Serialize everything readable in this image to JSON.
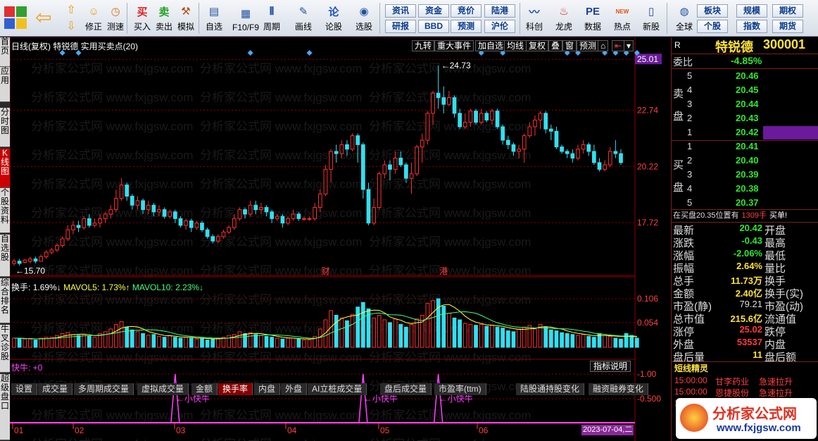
{
  "toolbar": {
    "buttons": [
      {
        "label": "修正",
        "icon": "arrow-up-icon"
      },
      {
        "label": "测速",
        "icon": "clock-icon"
      },
      {
        "label": "买入",
        "icon": "buy-icon"
      },
      {
        "label": "卖出",
        "icon": "sell-icon"
      },
      {
        "label": "模拟",
        "icon": "hammer-icon"
      },
      {
        "label": "自选",
        "icon": "folder-icon"
      },
      {
        "label": "F10/F9",
        "icon": "f10-icon"
      },
      {
        "label": "周期",
        "icon": "period-icon"
      },
      {
        "label": "画线",
        "icon": "pencil-icon"
      },
      {
        "label": "论股",
        "icon": "forum-icon"
      },
      {
        "label": "选股",
        "icon": "select-stock-icon"
      },
      {
        "label": "科创",
        "icon": "kechuang-icon"
      },
      {
        "label": "龙虎",
        "icon": "dragon-tiger-icon"
      },
      {
        "label": "数据",
        "icon": "pe-icon"
      },
      {
        "label": "热点",
        "icon": "hot-icon"
      },
      {
        "label": "新股",
        "icon": "new-stock-icon"
      },
      {
        "label": "全球",
        "icon": "globe-icon"
      }
    ],
    "glyphs": {
      "buy": "买",
      "sell": "卖",
      "forum": "论",
      "pe": "PE",
      "hot": "NEW"
    },
    "menu": [
      [
        "资讯",
        "资金",
        "竞价",
        "陆港"
      ],
      [
        "研报",
        "BBD",
        "预测",
        "沪伦"
      ],
      [
        "板块",
        "规模",
        "期权"
      ],
      [
        "个股",
        "指数",
        "期货"
      ]
    ]
  },
  "leftnav": [
    "首页",
    "应用",
    "分时图",
    "K线图",
    "个股资料",
    "自选股",
    "综合排名",
    "牛叉诊股",
    "超级盘口"
  ],
  "chart": {
    "title": "日线(复权)  特锐德  实用买卖点(20)",
    "tabs": [
      "九转",
      "重大事件",
      "加自选",
      "均线",
      "复权",
      "叠",
      "窗",
      "预测"
    ],
    "price_labels": [
      "25.01",
      "22.74",
      "20.22",
      "17.72"
    ],
    "high_label": "24.73",
    "low_label": "15.70",
    "event_labels": [
      "财",
      "港"
    ],
    "volume_indicator": {
      "name": "换手:",
      "value": "1.69%",
      "arrow1": "↓",
      "ma5_label": "MAVOL5:",
      "ma5": "1.73%",
      "arrow2": "↑",
      "ma10_label": "MAVOL10:",
      "ma10": "2.23%",
      "arrow3": "↓"
    },
    "volume_ticks": [
      "0.106",
      "0.054"
    ],
    "bottom_tabs": [
      "设置",
      "成交量",
      "多周期成交量",
      "虚拟成交量",
      "金额",
      "换手率",
      "内盘",
      "外盘",
      "AI立桩成交量",
      "盘后成交量",
      "市盈率(ttm)",
      "陆股通持股变化",
      "融资融券变化"
    ],
    "active_bottom_tab": "换手率",
    "fast_title": "快牛: +0",
    "indicator_button": "指标说明",
    "fast_ticks": [
      "1.00",
      "0.500"
    ],
    "signal_label": "小快牛",
    "date_labels": [
      "01",
      "02",
      "03",
      "04",
      "05",
      "06"
    ],
    "date_current": "2023-07-04,二",
    "watermark": "分析家公式网 www.fxjgsw.com",
    "colors": {
      "up": "#ff3030",
      "down": "#30e0f0",
      "grid": "#8a0000",
      "magenta": "#ff40ff"
    }
  },
  "chart_data": {
    "type": "candlestick",
    "high": 24.73,
    "low": 15.7,
    "price_axis": [
      17.72,
      20.22,
      22.74,
      25.01
    ],
    "candles": [
      [
        15.9,
        16.0,
        15.8,
        16.1
      ],
      [
        16.0,
        15.9,
        15.8,
        16.1
      ],
      [
        15.95,
        16.05,
        15.9,
        16.1
      ],
      [
        16.0,
        16.1,
        15.9,
        16.2
      ],
      [
        16.1,
        16.0,
        15.9,
        16.2
      ],
      [
        16.0,
        16.2,
        16.0,
        16.3
      ],
      [
        16.2,
        16.4,
        16.1,
        16.5
      ],
      [
        16.4,
        16.5,
        16.3,
        16.6
      ],
      [
        16.5,
        16.7,
        16.4,
        16.8
      ],
      [
        16.7,
        17.0,
        16.6,
        17.1
      ],
      [
        17.0,
        17.4,
        16.9,
        17.6
      ],
      [
        17.4,
        17.6,
        17.2,
        17.8
      ],
      [
        17.6,
        17.5,
        17.3,
        17.8
      ],
      [
        17.5,
        17.9,
        17.4,
        18.0
      ],
      [
        17.9,
        17.6,
        17.5,
        18.1
      ],
      [
        17.6,
        17.7,
        17.5,
        17.9
      ],
      [
        17.7,
        17.9,
        17.5,
        18.1
      ],
      [
        17.9,
        18.1,
        17.7,
        18.2
      ],
      [
        18.1,
        18.3,
        17.9,
        18.5
      ],
      [
        18.3,
        18.8,
        18.2,
        19.2
      ],
      [
        18.8,
        19.4,
        18.7,
        19.7
      ],
      [
        19.4,
        18.9,
        18.7,
        19.5
      ],
      [
        18.9,
        18.5,
        18.3,
        19.0
      ],
      [
        18.5,
        18.7,
        18.3,
        18.9
      ],
      [
        18.7,
        18.3,
        18.1,
        18.8
      ],
      [
        18.3,
        18.5,
        18.1,
        18.7
      ],
      [
        18.5,
        18.2,
        18.0,
        18.6
      ],
      [
        18.2,
        18.3,
        18.0,
        18.5
      ],
      [
        18.3,
        18.0,
        17.9,
        18.4
      ],
      [
        18.0,
        18.2,
        17.9,
        18.3
      ],
      [
        18.2,
        17.9,
        17.7,
        18.3
      ],
      [
        17.9,
        17.6,
        17.5,
        18.0
      ],
      [
        17.6,
        17.8,
        17.4,
        17.9
      ],
      [
        17.8,
        17.5,
        17.3,
        17.9
      ],
      [
        17.5,
        17.7,
        17.4,
        17.8
      ],
      [
        17.7,
        17.4,
        17.3,
        17.8
      ],
      [
        17.4,
        17.1,
        17.0,
        17.5
      ],
      [
        17.1,
        16.9,
        16.8,
        17.2
      ],
      [
        16.9,
        17.1,
        16.8,
        17.2
      ],
      [
        17.1,
        17.3,
        17.0,
        17.4
      ],
      [
        17.3,
        17.5,
        17.2,
        17.6
      ],
      [
        17.5,
        17.9,
        17.4,
        18.1
      ],
      [
        17.9,
        18.3,
        17.8,
        18.4
      ],
      [
        18.3,
        18.1,
        17.9,
        18.4
      ],
      [
        18.1,
        18.5,
        18.0,
        18.7
      ],
      [
        18.5,
        18.3,
        18.1,
        18.7
      ],
      [
        18.3,
        18.4,
        18.1,
        18.6
      ],
      [
        18.4,
        18.2,
        18.0,
        18.5
      ],
      [
        18.2,
        17.9,
        17.7,
        18.3
      ],
      [
        17.9,
        18.0,
        17.8,
        18.1
      ],
      [
        18.0,
        17.7,
        17.5,
        18.1
      ],
      [
        17.7,
        17.9,
        17.6,
        18.0
      ],
      [
        17.9,
        18.1,
        17.8,
        18.3
      ],
      [
        18.1,
        17.9,
        17.8,
        18.2
      ],
      [
        17.9,
        17.9,
        17.8,
        18.0
      ],
      [
        17.9,
        17.9,
        17.8,
        18.0
      ],
      [
        17.9,
        18.4,
        17.8,
        18.6
      ],
      [
        18.4,
        19.0,
        18.2,
        19.2
      ],
      [
        19.0,
        20.1,
        18.9,
        20.3
      ],
      [
        20.1,
        20.9,
        19.5,
        21.0
      ],
      [
        20.9,
        20.8,
        20.4,
        21.2
      ],
      [
        20.8,
        21.2,
        20.6,
        21.4
      ],
      [
        21.2,
        21.0,
        20.7,
        21.4
      ],
      [
        21.0,
        21.6,
        20.9,
        21.7
      ],
      [
        21.6,
        21.2,
        20.4,
        21.7
      ],
      [
        21.2,
        19.2,
        18.8,
        21.3
      ],
      [
        19.2,
        17.7,
        17.6,
        19.5
      ],
      [
        17.7,
        18.4,
        17.6,
        18.8
      ],
      [
        18.4,
        19.9,
        18.3,
        20.0
      ],
      [
        19.9,
        20.3,
        19.7,
        20.5
      ],
      [
        20.3,
        20.1,
        19.6,
        20.5
      ],
      [
        20.1,
        20.6,
        19.9,
        20.9
      ],
      [
        20.6,
        20.3,
        20.2,
        20.9
      ],
      [
        20.3,
        19.7,
        19.5,
        20.4
      ],
      [
        19.7,
        19.9,
        19.0,
        20.4
      ],
      [
        19.9,
        21.1,
        19.8,
        21.2
      ],
      [
        21.1,
        21.4,
        20.4,
        21.7
      ],
      [
        21.4,
        22.6,
        21.2,
        22.7
      ],
      [
        22.6,
        23.5,
        22.1,
        23.6
      ],
      [
        23.5,
        23.3,
        22.8,
        24.73
      ],
      [
        23.3,
        23.0,
        22.6,
        23.8
      ],
      [
        23.0,
        23.3,
        22.9,
        23.6
      ],
      [
        23.3,
        22.6,
        22.4,
        23.4
      ],
      [
        22.6,
        22.0,
        21.9,
        22.8
      ],
      [
        22.0,
        22.2,
        21.9,
        22.6
      ],
      [
        22.2,
        22.7,
        22.0,
        22.8
      ],
      [
        22.7,
        22.2,
        22.1,
        22.8
      ],
      [
        22.2,
        22.6,
        22.1,
        22.8
      ],
      [
        22.6,
        22.3,
        22.2,
        22.7
      ],
      [
        22.3,
        22.7,
        22.1,
        22.8
      ],
      [
        22.7,
        22.0,
        21.9,
        22.8
      ],
      [
        22.0,
        21.4,
        21.2,
        22.1
      ],
      [
        21.4,
        21.2,
        21.0,
        21.6
      ],
      [
        21.2,
        20.9,
        20.7,
        21.3
      ],
      [
        20.9,
        21.0,
        20.6,
        21.2
      ],
      [
        21.0,
        21.6,
        20.4,
        21.7
      ],
      [
        21.6,
        22.0,
        21.5,
        22.2
      ],
      [
        22.0,
        22.3,
        21.6,
        22.5
      ],
      [
        22.3,
        22.6,
        21.9,
        22.7
      ],
      [
        22.6,
        21.9,
        21.7,
        22.7
      ],
      [
        21.9,
        21.8,
        21.4,
        22.1
      ],
      [
        21.8,
        21.1,
        21.0,
        22.0
      ],
      [
        21.1,
        20.9,
        20.8,
        21.2
      ],
      [
        20.9,
        20.8,
        20.6,
        21.0
      ],
      [
        20.8,
        20.6,
        20.4,
        21.0
      ],
      [
        20.6,
        21.0,
        20.5,
        21.2
      ],
      [
        21.0,
        21.2,
        20.8,
        21.4
      ],
      [
        21.2,
        20.9,
        20.7,
        21.3
      ],
      [
        20.9,
        20.4,
        20.3,
        21.2
      ],
      [
        20.4,
        20.1,
        20.0,
        20.6
      ],
      [
        20.1,
        20.3,
        20.0,
        20.5
      ],
      [
        20.3,
        20.9,
        20.2,
        21.1
      ],
      [
        20.9,
        20.8,
        20.6,
        21.4
      ],
      [
        20.8,
        20.4,
        20.3,
        21.0
      ]
    ],
    "turnover": [
      0.02,
      0.02,
      0.018,
      0.018,
      0.016,
      0.02,
      0.022,
      0.022,
      0.026,
      0.03,
      0.032,
      0.028,
      0.026,
      0.028,
      0.024,
      0.022,
      0.03,
      0.034,
      0.04,
      0.05,
      0.056,
      0.044,
      0.038,
      0.034,
      0.03,
      0.026,
      0.028,
      0.024,
      0.022,
      0.026,
      0.022,
      0.02,
      0.022,
      0.02,
      0.018,
      0.02,
      0.016,
      0.018,
      0.02,
      0.022,
      0.026,
      0.028,
      0.034,
      0.03,
      0.032,
      0.028,
      0.026,
      0.024,
      0.022,
      0.02,
      0.018,
      0.02,
      0.02,
      0.018,
      0.016,
      0.016,
      0.024,
      0.04,
      0.06,
      0.08,
      0.07,
      0.064,
      0.058,
      0.072,
      0.088,
      0.098,
      0.084,
      0.064,
      0.07,
      0.06,
      0.054,
      0.062,
      0.05,
      0.044,
      0.05,
      0.062,
      0.07,
      0.096,
      0.102,
      0.106,
      0.09,
      0.074,
      0.064,
      0.06,
      0.052,
      0.05,
      0.048,
      0.05,
      0.046,
      0.048,
      0.044,
      0.042,
      0.036,
      0.034,
      0.04,
      0.044,
      0.048,
      0.04,
      0.05,
      0.044,
      0.038,
      0.036,
      0.032,
      0.03,
      0.028,
      0.026,
      0.028,
      0.024,
      0.022,
      0.03,
      0.026,
      0.024,
      0.02,
      0.018,
      0.03,
      0.026,
      0.02
    ],
    "signal_indices": [
      30,
      65,
      79
    ],
    "fast_axis": [
      0.5,
      1.0
    ]
  },
  "right": {
    "name": "特锐德",
    "code": "300001",
    "r": "R",
    "weibi_label": "委比",
    "weibi": "-4.85%",
    "sell_label": [
      "卖",
      "盘"
    ],
    "buy_label": [
      "买",
      "盘"
    ],
    "sell": [
      {
        "n": "5",
        "p": "20.46"
      },
      {
        "n": "4",
        "p": "20.45"
      },
      {
        "n": "3",
        "p": "20.44"
      },
      {
        "n": "2",
        "p": "20.43"
      },
      {
        "n": "1",
        "p": "20.42"
      }
    ],
    "buy": [
      {
        "n": "1",
        "p": "20.41"
      },
      {
        "n": "2",
        "p": "20.40"
      },
      {
        "n": "3",
        "p": "20.39"
      },
      {
        "n": "4",
        "p": "20.38"
      },
      {
        "n": "5",
        "p": "20.37"
      }
    ],
    "notice": {
      "t1": "在买盘20.35位置有",
      "t2": "1309手",
      "t3": "买单!"
    },
    "stats": [
      {
        "l": "最新",
        "v": "20.42",
        "c": "grn",
        "r": "开盘",
        "rc": ""
      },
      {
        "l": "涨跌",
        "v": "-0.43",
        "c": "grn",
        "r": "最高",
        "rc": ""
      },
      {
        "l": "涨幅",
        "v": "-2.06%",
        "c": "grn",
        "r": "最低",
        "rc": ""
      },
      {
        "l": "振幅",
        "v": "2.64%",
        "c": "yel",
        "r": "量比",
        "rc": ""
      },
      {
        "l": "总手",
        "v": "11.73万",
        "c": "yel",
        "r": "换手",
        "rc": ""
      },
      {
        "l": "金额",
        "v": "2.40亿",
        "c": "yel",
        "r": "换手(实)",
        "rc": ""
      },
      {
        "l": "市盈(静)",
        "v": "79.21",
        "c": "rlab",
        "r": "市盈(动)",
        "rc": ""
      },
      {
        "l": "总市值",
        "v": "215.6亿",
        "c": "yel",
        "r": "流通值",
        "rc": ""
      },
      {
        "l": "涨停",
        "v": "25.02",
        "c": "red",
        "r": "跌停",
        "rc": ""
      },
      {
        "l": "外盘",
        "v": "53537",
        "c": "red",
        "r": "内盘",
        "rc": ""
      },
      {
        "l": "盘后量",
        "v": "11",
        "c": "yel",
        "r": "盘后额",
        "rc": ""
      }
    ],
    "sprite_title": "短线精灵",
    "sprites": [
      {
        "t": "15:00:00",
        "n": "甘李药业",
        "e": "急速拉升"
      },
      {
        "t": "15:00:00",
        "n": "恩捷股份",
        "e": "急速拉升"
      },
      {
        "t": "15:00:00",
        "n": "",
        "e": "速拉升"
      }
    ],
    "logo_text": "分析家公式网",
    "logo_url": "www.fxjgsw.com"
  }
}
